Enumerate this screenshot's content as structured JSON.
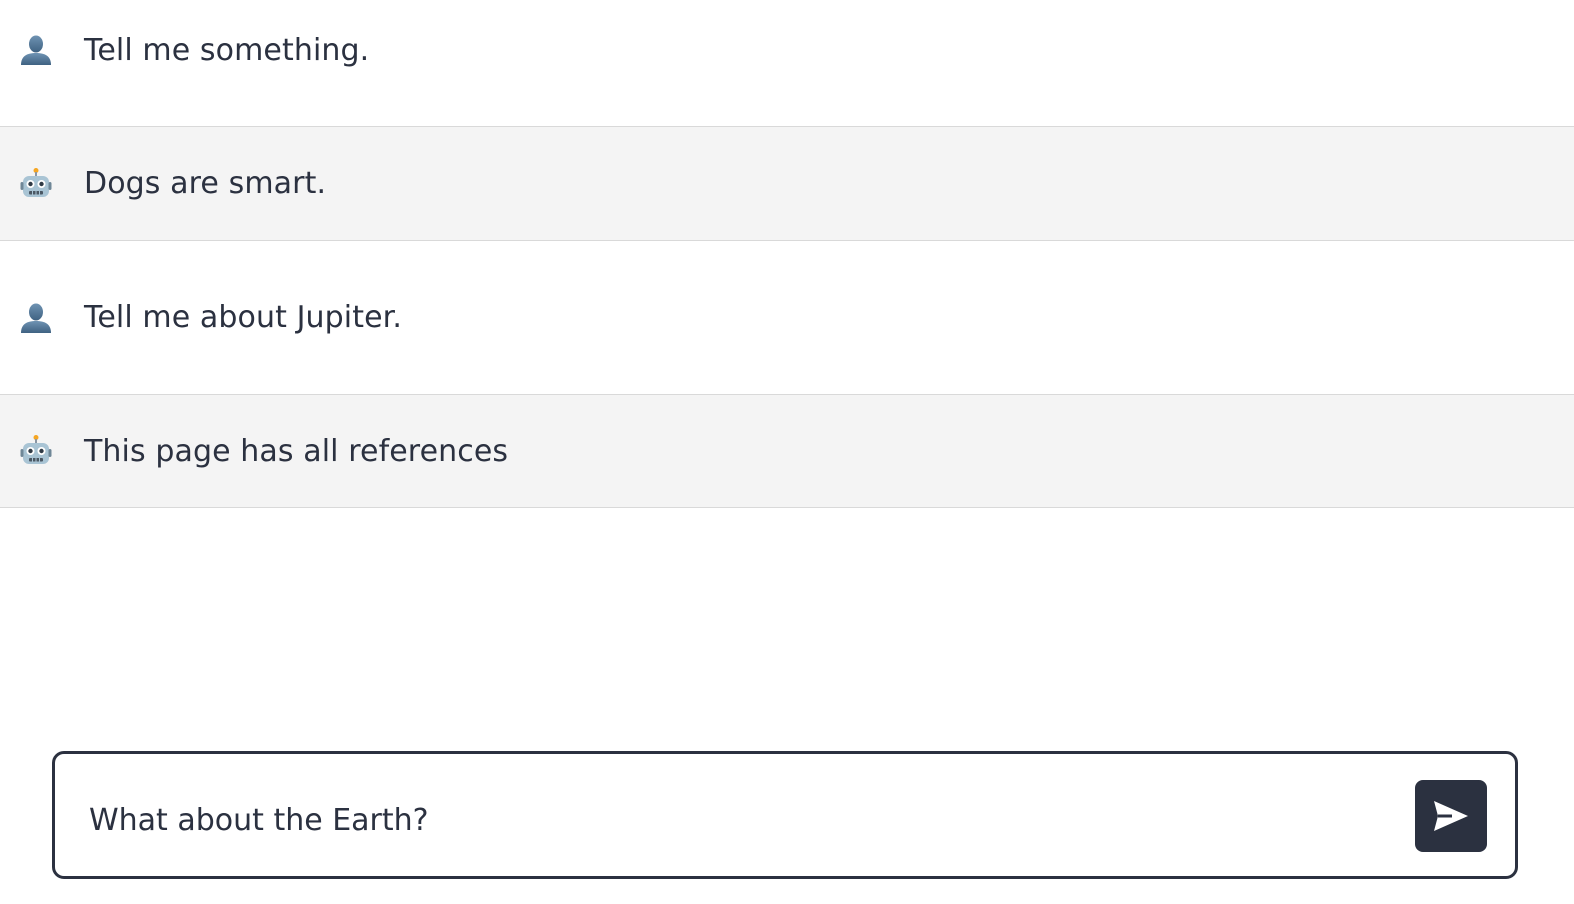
{
  "messages": [
    {
      "role": "user",
      "icon": "user-icon",
      "text": "Tell me something."
    },
    {
      "role": "assistant",
      "icon": "robot-icon",
      "text": "Dogs are smart."
    },
    {
      "role": "user",
      "icon": "user-icon",
      "text": "Tell me about Jupiter."
    },
    {
      "role": "assistant",
      "icon": "robot-icon",
      "text": "This page has all references"
    }
  ],
  "composer": {
    "value": "What about the Earth?",
    "send_icon": "send-icon"
  },
  "colors": {
    "text": "#2b3140",
    "assistant_bg": "#f4f4f4",
    "divider": "#d9d9d9",
    "send_button": "#2b3140"
  }
}
